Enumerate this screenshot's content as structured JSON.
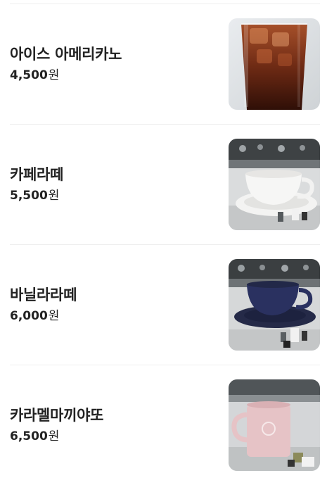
{
  "menu": {
    "currency_unit": "원",
    "items": [
      {
        "name": "아이스 아메리카노",
        "price": "4,500",
        "image": "iced-americano-photo"
      },
      {
        "name": "카페라떼",
        "price": "5,500",
        "image": "white-cup-latte-photo"
      },
      {
        "name": "바닐라라떼",
        "price": "6,000",
        "image": "navy-cup-vanilla-latte-photo"
      },
      {
        "name": "카라멜마끼야또",
        "price": "6,500",
        "image": "pink-mug-caramel-macchiato-photo"
      }
    ]
  },
  "colors": {
    "text": "#222222",
    "divider": "#eeeeee"
  }
}
